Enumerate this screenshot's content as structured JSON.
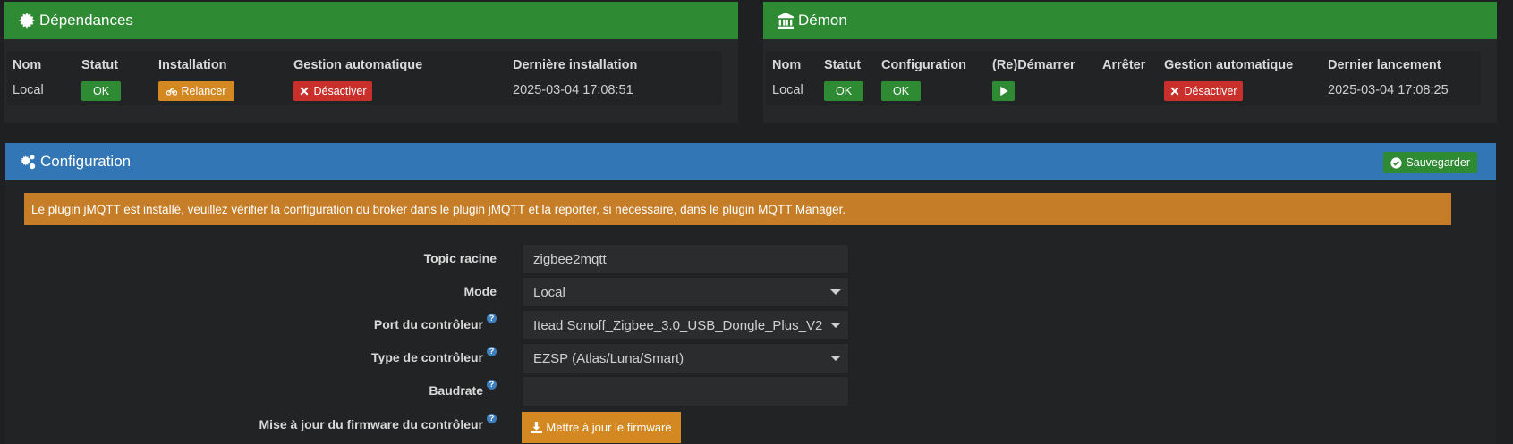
{
  "deps": {
    "title": "Dépendances",
    "headers": [
      "Nom",
      "Statut",
      "Installation",
      "Gestion automatique",
      "Dernière installation"
    ],
    "row": {
      "name": "Local",
      "status": "OK",
      "install_btn": "Relancer",
      "auto_btn": "Désactiver",
      "last": "2025-03-04 17:08:51"
    }
  },
  "daemon": {
    "title": "Démon",
    "headers": [
      "Nom",
      "Statut",
      "Configuration",
      "(Re)Démarrer",
      "Arrêter",
      "Gestion automatique",
      "Dernier lancement"
    ],
    "row": {
      "name": "Local",
      "status": "OK",
      "config": "OK",
      "auto_btn": "Désactiver",
      "last": "2025-03-04 17:08:25"
    }
  },
  "config": {
    "title": "Configuration",
    "save_label": "Sauvegarder",
    "alert": "Le plugin jMQTT est installé, veuillez vérifier la configuration du broker dans le plugin jMQTT et la reporter, si nécessaire, dans le plugin MQTT Manager.",
    "fields": {
      "topic_label": "Topic racine",
      "topic_value": "zigbee2mqtt",
      "mode_label": "Mode",
      "mode_value": "Local",
      "port_label": "Port du contrôleur",
      "port_value": "Itead Sonoff_Zigbee_3.0_USB_Dongle_Plus_V2",
      "type_label": "Type de contrôleur",
      "type_value": "EZSP (Atlas/Luna/Smart)",
      "baud_label": "Baudrate",
      "baud_value": "",
      "fw_label": "Mise à jour du firmware du contrôleur",
      "fw_button": "Mettre à jour le firmware"
    }
  },
  "colors": {
    "green": "#2e8b34",
    "blue": "#3276b5",
    "orange": "#d48821",
    "red": "#c9302c"
  }
}
